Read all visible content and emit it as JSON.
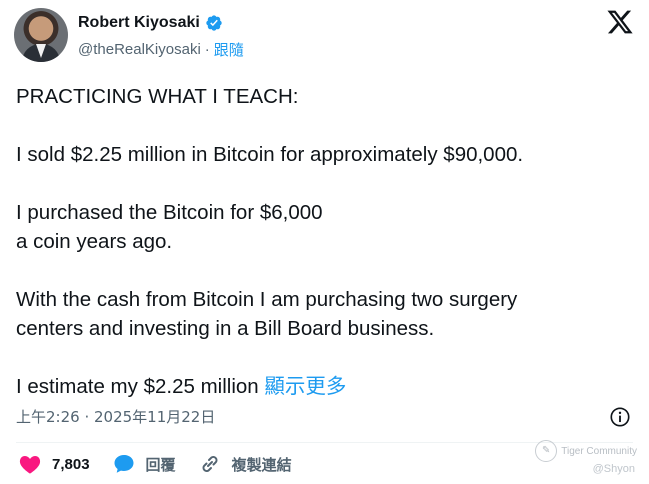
{
  "author": {
    "name": "Robert Kiyosaki",
    "handle": "@theRealKiyosaki",
    "separator": "·",
    "follow_label": "跟隨"
  },
  "tweet": {
    "lines": [
      "PRACTICING WHAT I TEACH:",
      "I sold $2.25 million in Bitcoin for approximately $90,000.",
      "I purchased the Bitcoin for $6,000",
      "a coin years ago.",
      "With the cash from Bitcoin I am purchasing two surgery",
      "centers and investing in a Bill Board business.",
      "I estimate my $2.25 million"
    ],
    "show_more": "顯示更多",
    "timestamp": "上午2:26 · 2025年11月22日"
  },
  "actions": {
    "likes": "7,803",
    "reply_label": "回覆",
    "copy_link_label": "複製連結"
  },
  "watermark": {
    "community": "Tiger Community",
    "user": "@Shyon"
  },
  "colors": {
    "accent": "#1d9bf0",
    "like": "#f91880",
    "text": "#0f1419",
    "muted": "#536471"
  },
  "icons": [
    "verified-badge-icon",
    "x-logo-icon",
    "info-icon",
    "heart-icon",
    "reply-bubble-icon",
    "link-icon"
  ]
}
